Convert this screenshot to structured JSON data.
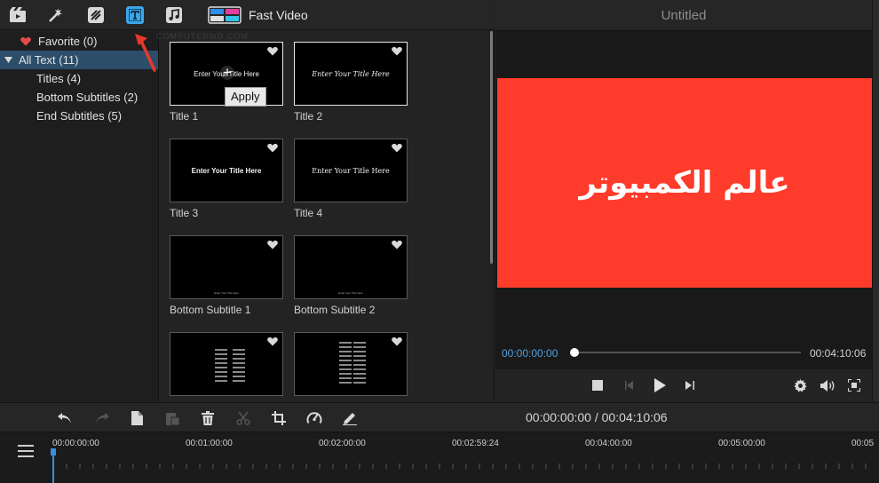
{
  "toolbar": {
    "icons": [
      "media-icon",
      "effects-icon",
      "transitions-icon",
      "text-icon",
      "music-icon"
    ],
    "fast_video_label": "Fast Video",
    "accent_color": "#3aa7ea"
  },
  "categories": [
    {
      "label": "Favorite (0)",
      "icon": "heart-icon"
    },
    {
      "label": "All Text (11)",
      "icon": "triangle-down-icon"
    },
    {
      "label": "Titles (4)"
    },
    {
      "label": "Bottom Subtitles (2)"
    },
    {
      "label": "End Subtitles (5)"
    }
  ],
  "templates": [
    {
      "label": "Title 1",
      "thumb_text": "Enter Your Title Here"
    },
    {
      "label": "Title 2",
      "thumb_text": "Enter Your Title Here"
    },
    {
      "label": "Title 3",
      "thumb_text": "Enter Your Title Here"
    },
    {
      "label": "Title 4",
      "thumb_text": "Enter Your Title Here"
    },
    {
      "label": "Bottom Subtitle 1",
      "thumb_text": "Enter Your Title Here"
    },
    {
      "label": "Bottom Subtitle 2",
      "thumb_text": "Enter Your Title Here"
    }
  ],
  "apply_tooltip": "Apply",
  "watermark": "COMPUTERWD.COM",
  "preview": {
    "title": "Untitled",
    "video_text": "عالم الكمبيوتر",
    "video_color": "#ff3b2b",
    "current_time": "00:00:00:00",
    "total_time": "00:04:10:06"
  },
  "timeline": {
    "time_display": "00:00:00:00 / 00:04:10:06",
    "ticks": [
      "00:00:00:00",
      "00:01:00:00",
      "00:02:00:00",
      "00:02:59:24",
      "00:04:00:00",
      "00:05:00:00",
      "00:05"
    ]
  }
}
